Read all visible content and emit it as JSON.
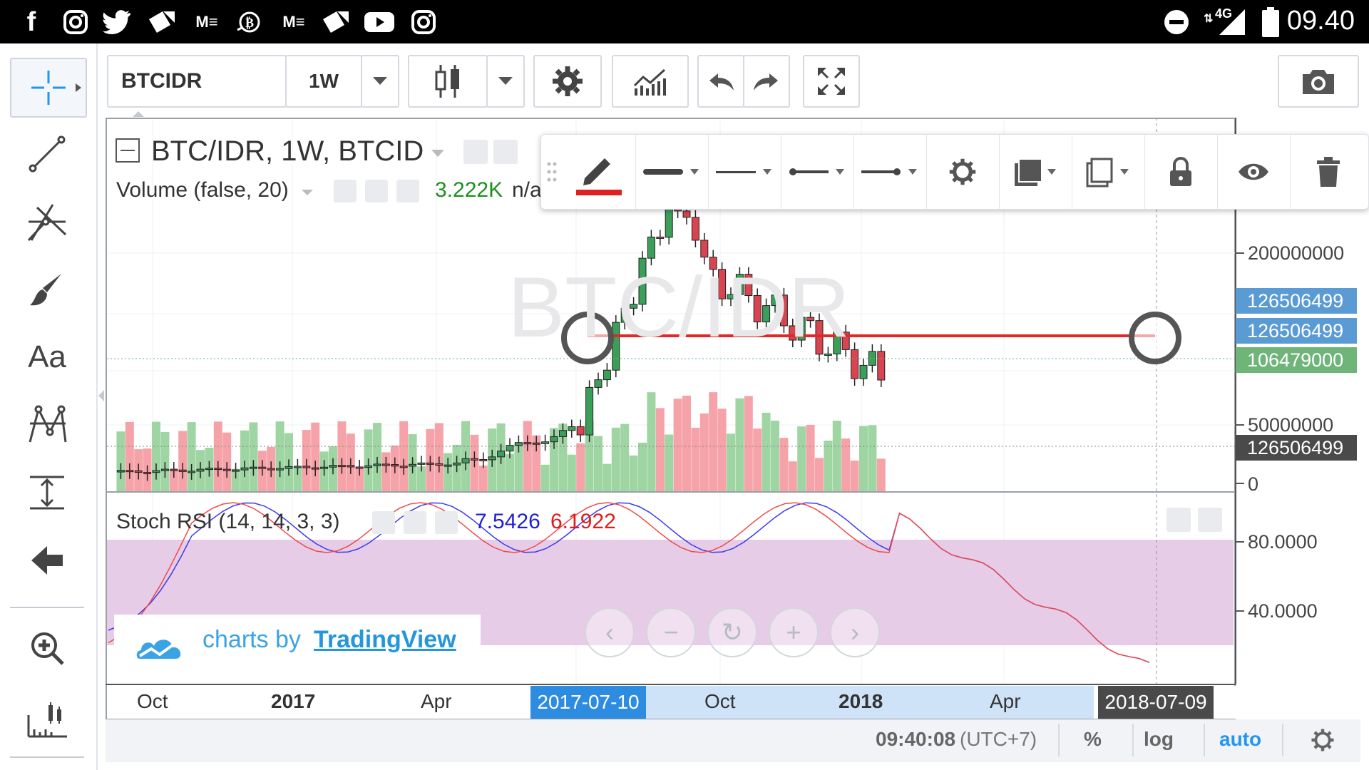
{
  "status_bar": {
    "time": "09.40",
    "network": "4G",
    "icons": [
      "facebook-icon",
      "instagram-icon",
      "twitter-icon",
      "arrow-app-icon",
      "medium-icon",
      "bitcoin-icon",
      "medium-icon-2",
      "arrow-app-icon-2",
      "youtube-icon",
      "instagram-icon-2"
    ]
  },
  "toolbar": {
    "symbol": "BTCIDR",
    "interval": "1W"
  },
  "chart": {
    "legend_title": "BTC/IDR, 1W, BTCID",
    "watermark": "BTC/IDR",
    "volume_label": "Volume (false, 20)",
    "volume_value": "3.222K",
    "volume_na": "n/a",
    "stoch_label": "Stoch RSI (14, 14, 3, 3)",
    "stoch_k": "7.5426",
    "stoch_d": "6.1922",
    "branding_prefix": "charts by ",
    "branding_link": "TradingView"
  },
  "price_axis": {
    "labels": [
      "200000000",
      "50000000",
      "0",
      "80.0000",
      "40.0000"
    ],
    "tags": [
      "126506499",
      "126506499",
      "106479000",
      "126506499"
    ],
    "colors": {
      "blue": "#5b9bd5",
      "green": "#6fb57a",
      "dark": "#4a4a4a"
    }
  },
  "time_axis": {
    "labels": [
      "Oct",
      "2017",
      "Apr",
      "Oct",
      "2018",
      "Apr"
    ],
    "selected_start": "2017-07-10",
    "selected_end": "2018-07-09"
  },
  "bottom_bar": {
    "clock": "09:40:08",
    "tz": "(UTC+7)",
    "percent": "%",
    "log": "log",
    "auto": "auto"
  },
  "colors": {
    "up": "#53b987",
    "down": "#eb4d5c",
    "line": "#e32626",
    "stoch_band": "#e6cce6",
    "stoch_k": "#3a3af0",
    "stoch_d": "#ef4a4a",
    "accent": "#2196f3"
  }
}
